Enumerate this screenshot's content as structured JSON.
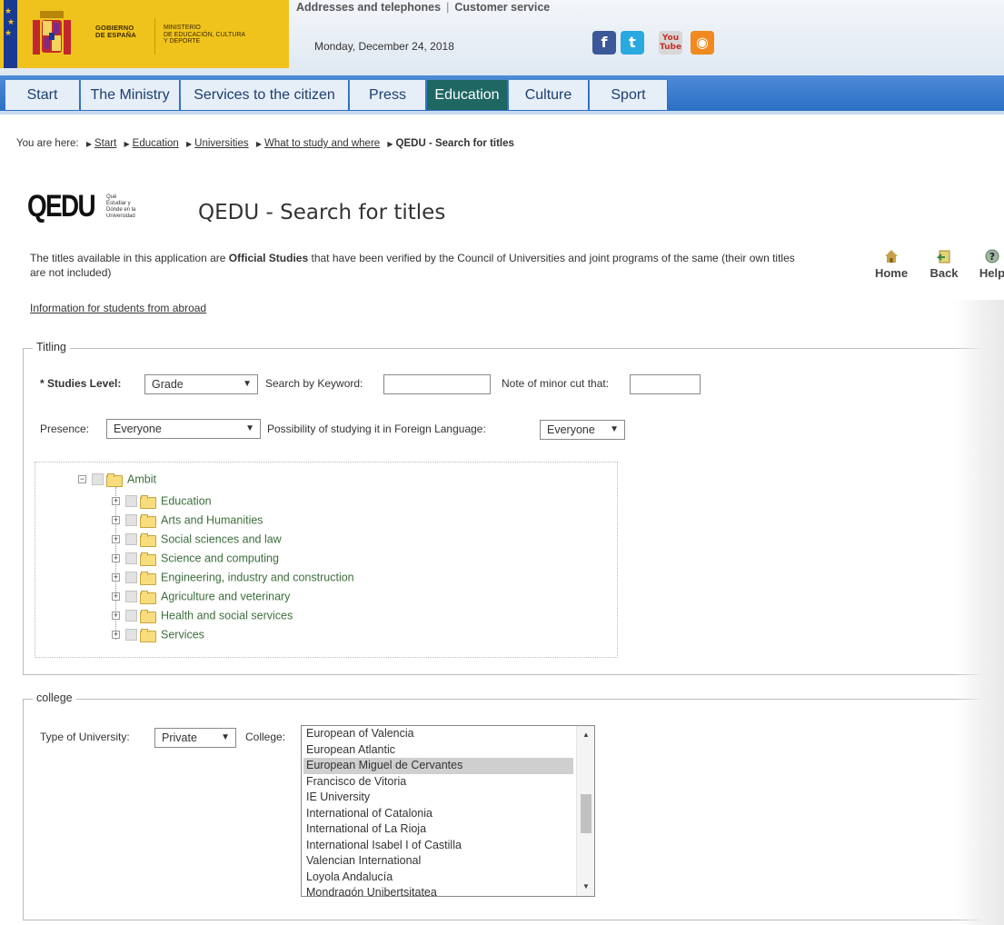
{
  "header": {
    "gov_label": [
      "GOBIERNO",
      "DE ESPAÑA"
    ],
    "ministry_label": [
      "MINISTERIO",
      "DE EDUCACIÓN, CULTURA",
      "Y DEPORTE"
    ],
    "top_links": [
      "Addresses and telephones",
      "Customer service"
    ],
    "date": "Monday, December 24, 2018",
    "social": [
      {
        "name": "facebook-icon",
        "glyph": "f"
      },
      {
        "name": "twitter-icon",
        "glyph": "t"
      },
      {
        "name": "youtube-icon",
        "glyph": "You Tube"
      },
      {
        "name": "rss-icon",
        "glyph": "◉"
      }
    ],
    "colors": {
      "gov_yellow": "#f0c31c",
      "flag_blue": "#1a3a91"
    }
  },
  "nav": {
    "tabs": [
      {
        "label": "Start"
      },
      {
        "label": "The Ministry"
      },
      {
        "label": "Services to the citizen"
      },
      {
        "label": "Press"
      },
      {
        "label": "Education",
        "active": true
      },
      {
        "label": "Culture"
      },
      {
        "label": "Sport"
      }
    ],
    "colors": {
      "bar": "#3a7bcd",
      "active": "#1f6763"
    }
  },
  "breadcrumb": {
    "prefix": "You are here:",
    "links": [
      "Start",
      "Education",
      "Universities",
      "What to study and where"
    ],
    "current": "QEDU - Search for titles"
  },
  "title": {
    "logo": "QEDU",
    "logo_sub": [
      "Qué",
      "Estudiar y",
      "Dónde en la",
      "Universidad"
    ],
    "heading": "QEDU - Search for titles"
  },
  "intro": {
    "part1": "The titles available in this application are ",
    "bold": "Official Studies",
    "part2": " that have been verified by the Council of Universities and joint programs of the same (their own titles are not included)",
    "info_link": "Information for students from abroad"
  },
  "tools": {
    "home": "Home",
    "back": "Back",
    "help": "Help"
  },
  "titling": {
    "legend": "Titling",
    "studies_level_label": "* Studies Level:",
    "studies_level_value": "Grade",
    "keyword_label": "Search by Keyword:",
    "keyword_value": "",
    "minor_cut_label": "Note of minor cut that:",
    "minor_cut_value": "",
    "presence_label": "Presence:",
    "presence_value": "Everyone",
    "foreign_label": "Possibility of studying it in Foreign Language:",
    "foreign_value": "Everyone",
    "tree_root": "Ambit",
    "tree_items": [
      "Education",
      "Arts and Humanities",
      "Social sciences and law",
      "Science and computing",
      "Engineering, industry and construction",
      "Agriculture and veterinary",
      "Health and social services",
      "Services"
    ]
  },
  "college": {
    "legend": "college",
    "type_label": "Type of University:",
    "type_value": "Private",
    "college_label": "College:",
    "colleges": [
      "European of Valencia",
      "European Atlantic",
      "European Miguel de Cervantes",
      "Francisco de Vitoria",
      "IE University",
      "International of Catalonia",
      "International of La Rioja",
      "International Isabel I of Castilla",
      "Valencian International",
      "Loyola Andalucía",
      "Mondragón Unibertsitatea"
    ],
    "selected_index": 2
  }
}
